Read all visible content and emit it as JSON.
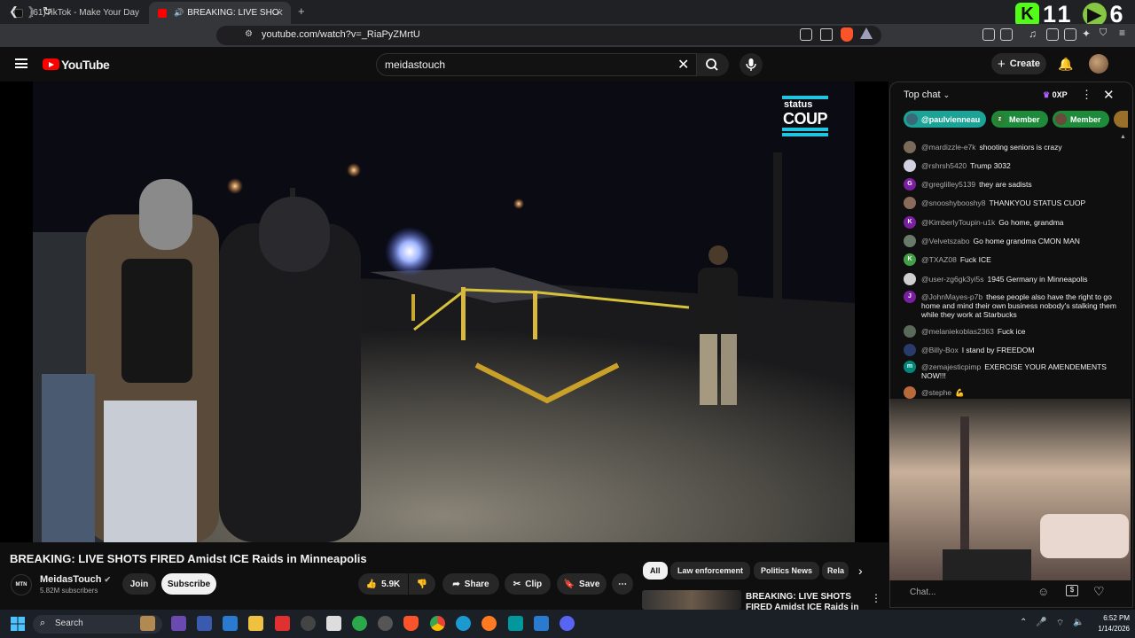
{
  "browser": {
    "tabs": [
      {
        "label": "(61)TikTok - Make Your Day"
      },
      {
        "label": "BREAKING: LIVE SHOTS FIRED"
      }
    ],
    "url": "youtube.com/watch?v=_RiaPyZMrtU",
    "overlay_counts": [
      "11",
      "6"
    ]
  },
  "header": {
    "logo_text": "YouTube",
    "search_value": "meidastouch",
    "create_label": "Create"
  },
  "video": {
    "watermark_line1": "status",
    "watermark_line2": "COUP",
    "title": "BREAKING: LIVE SHOTS FIRED Amidst ICE Raids in Minneapolis"
  },
  "channel": {
    "avatar_text": "MTN",
    "name": "MeidasTouch",
    "subscribers": "5.82M subscribers",
    "join_label": "Join",
    "subscribe_label": "Subscribe"
  },
  "actions": {
    "likes": "5.9K",
    "share": "Share",
    "clip": "Clip",
    "save": "Save"
  },
  "chips": [
    "All",
    "Law enforcement",
    "Politics News",
    "Rela"
  ],
  "recommendation": {
    "title": "BREAKING: LIVE SHOTS FIRED Amidst ICE Raids in"
  },
  "chat": {
    "title": "Top chat",
    "points": "0XP",
    "tickers": [
      {
        "label": "@paulvienneau",
        "color": "#1ba397"
      },
      {
        "label": "Member",
        "avatar": "z",
        "color": "#1e8b3a"
      },
      {
        "label": "Member",
        "color": "#1e8b3a"
      }
    ],
    "messages": [
      {
        "avatar": "",
        "avatar_color": "#7a6a5a",
        "author": "@mardizzle-e7k",
        "text": "shooting seniors is crazy"
      },
      {
        "avatar": "",
        "avatar_color": "#d0d0e0",
        "author": "@rshrsh5420",
        "text": "Trump 3032"
      },
      {
        "avatar": "G",
        "avatar_color": "#7b1fa2",
        "author": "@greglilley5139",
        "text": "they are sadists"
      },
      {
        "avatar": "",
        "avatar_color": "#8a6a5a",
        "author": "@snooshybooshy8",
        "text": "THANKYOU STATUS CUOP"
      },
      {
        "avatar": "K",
        "avatar_color": "#7b1fa2",
        "author": "@KimberlyToupin-u1k",
        "text": "Go home, grandma"
      },
      {
        "avatar": "",
        "avatar_color": "#6a7a6a",
        "author": "@Velvetszabo",
        "text": "Go home grandma CMON MAN"
      },
      {
        "avatar": "K",
        "avatar_color": "#43a047",
        "author": "@TXAZ08",
        "text": "Fuck ICE"
      },
      {
        "avatar": "",
        "avatar_color": "#cfcfcf",
        "author": "@user-zg6gk3yi5s",
        "text": "1945 Germany in Minneapolis"
      },
      {
        "avatar": "J",
        "avatar_color": "#7b1fa2",
        "author": "@JohnMayes-p7b",
        "text": "these people also have the right to go home and mind their own business nobody's stalking them while they work at Starbucks"
      },
      {
        "avatar": "",
        "avatar_color": "#5a6a5a",
        "author": "@melaniekoblas2363",
        "text": "Fuck ice"
      },
      {
        "avatar": "",
        "avatar_color": "#2a3a6a",
        "author": "@Billy-Box",
        "text": "I stand by FREEDOM"
      },
      {
        "avatar": "m",
        "avatar_color": "#00897b",
        "author": "@zemajesticpimp",
        "text": "EXERCISE YOUR AMENDEMENTS NOW!!!"
      },
      {
        "avatar": "",
        "avatar_color": "#b86a3a",
        "author": "@stephe",
        "text": "💪"
      }
    ],
    "input_placeholder": "Chat..."
  },
  "taskbar": {
    "search_label": "Search",
    "time": "6:52 PM",
    "date": "1/14/2026"
  }
}
